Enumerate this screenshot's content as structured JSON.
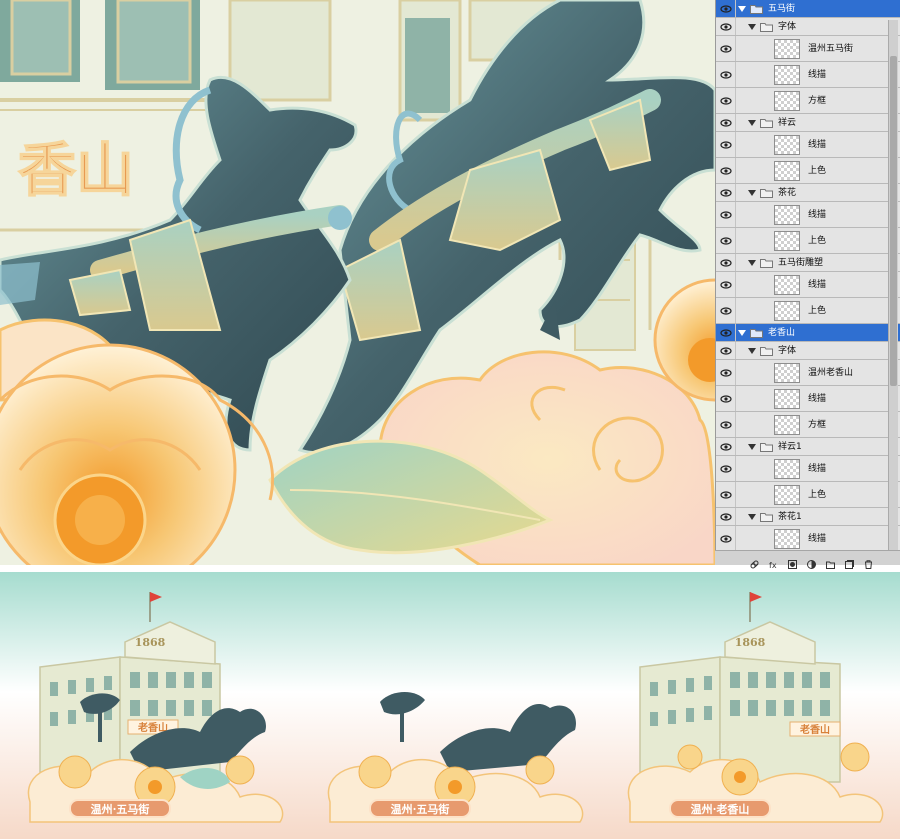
{
  "layers_panel": {
    "rows": [
      {
        "name": "五马街",
        "kind": "group",
        "indent": 0,
        "selected": true
      },
      {
        "name": "字体",
        "kind": "group",
        "indent": 1,
        "selected": false
      },
      {
        "name": "温州五马街",
        "kind": "layer",
        "indent": 2,
        "selected": false
      },
      {
        "name": "线描",
        "kind": "layer",
        "indent": 2,
        "selected": false
      },
      {
        "name": "方框",
        "kind": "layer",
        "indent": 2,
        "selected": false
      },
      {
        "name": "祥云",
        "kind": "group",
        "indent": 1,
        "selected": false
      },
      {
        "name": "线描",
        "kind": "layer",
        "indent": 2,
        "selected": false
      },
      {
        "name": "上色",
        "kind": "layer",
        "indent": 2,
        "selected": false
      },
      {
        "name": "茶花",
        "kind": "group",
        "indent": 1,
        "selected": false
      },
      {
        "name": "线描",
        "kind": "layer",
        "indent": 2,
        "selected": false
      },
      {
        "name": "上色",
        "kind": "layer",
        "indent": 2,
        "selected": false
      },
      {
        "name": "五马街雕塑",
        "kind": "group",
        "indent": 1,
        "selected": false
      },
      {
        "name": "线描",
        "kind": "layer",
        "indent": 2,
        "selected": false
      },
      {
        "name": "上色",
        "kind": "layer",
        "indent": 2,
        "selected": false
      },
      {
        "name": "老香山",
        "kind": "group",
        "indent": 0,
        "selected": true
      },
      {
        "name": "字体",
        "kind": "group",
        "indent": 1,
        "selected": false
      },
      {
        "name": "温州老香山",
        "kind": "layer",
        "indent": 2,
        "selected": false
      },
      {
        "name": "线描",
        "kind": "layer",
        "indent": 2,
        "selected": false
      },
      {
        "name": "方框",
        "kind": "layer",
        "indent": 2,
        "selected": false
      },
      {
        "name": "祥云1",
        "kind": "group",
        "indent": 1,
        "selected": false
      },
      {
        "name": "线描",
        "kind": "layer",
        "indent": 2,
        "selected": false
      },
      {
        "name": "上色",
        "kind": "layer",
        "indent": 2,
        "selected": false
      },
      {
        "name": "茶花1",
        "kind": "group",
        "indent": 1,
        "selected": false
      },
      {
        "name": "线描",
        "kind": "layer",
        "indent": 2,
        "selected": false
      }
    ],
    "footer_icons": [
      "link-icon",
      "fx-icon",
      "mask-icon",
      "adjustment-icon",
      "new-group-icon",
      "new-layer-icon",
      "trash-icon"
    ]
  },
  "artwork": {
    "sign_text": "香山"
  },
  "thumbnails": [
    {
      "year": "1868",
      "sign": "老香山",
      "caption": "温州·五马街"
    },
    {
      "caption": "温州·五马街"
    },
    {
      "year": "1868",
      "sign": "老香山",
      "caption": "温州·老香山"
    }
  ],
  "colors": {
    "horse": "#3f5b63",
    "horse_highlight": "#6c9aa0",
    "gold_line": "#e7c98a",
    "camellia": "#f7c774",
    "camellia_center": "#f39a2a",
    "building": "#e9edd9",
    "panel_selected": "#2f6fd1",
    "sky_teal": "#a6dccf",
    "ground_peach": "#f6d9c8",
    "label_orange": "#e79a6e"
  }
}
